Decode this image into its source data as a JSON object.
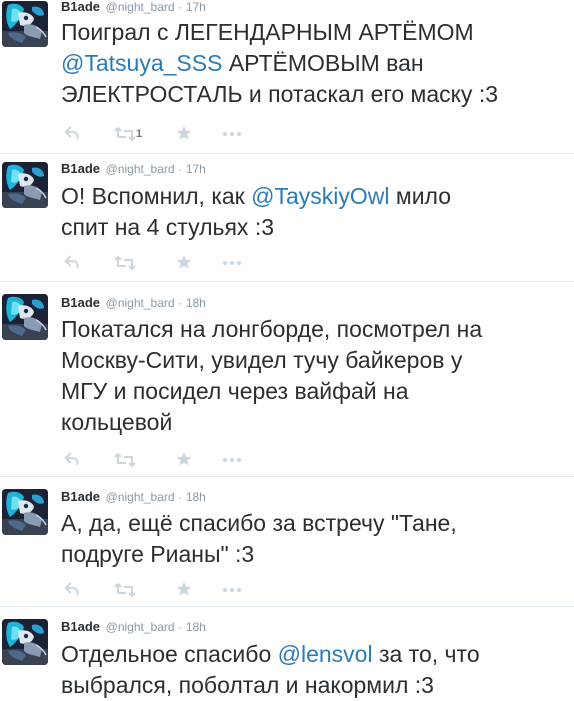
{
  "colors": {
    "mention": "#2b7bb9",
    "muted": "#8899a6",
    "text": "#292f33",
    "action_icon": "#ccd6dd"
  },
  "tweets": [
    {
      "name": "B1ade",
      "handle": "@night_bard",
      "separator": "·",
      "time": "17h",
      "text": {
        "l1a": "Поиграл с ЛЕГЕНДАРНЫМ АРТЁМОМ",
        "l2m": "@Tatsuya_SSS",
        "l2b": " АРТЁМОВЫМ ван",
        "l3": "ЭЛЕКТРОСТАЛЬ и потаскал его маску :3"
      },
      "retweet_count": "1"
    },
    {
      "name": "B1ade",
      "handle": "@night_bard",
      "separator": "·",
      "time": "17h",
      "text": {
        "l1a": "О! Вспомнил, как ",
        "l1m": "@TayskiyOwl",
        "l1b": " мило",
        "l2": "спит на 4 стульях :3"
      }
    },
    {
      "name": "B1ade",
      "handle": "@night_bard",
      "separator": "·",
      "time": "18h",
      "text": {
        "l1": "Покатался на лонгборде, посмотрел на",
        "l2": "Москву-Сити, увидел тучу байкеров у",
        "l3": "МГУ и посидел через вайфай на",
        "l4": "кольцевой"
      }
    },
    {
      "name": "B1ade",
      "handle": "@night_bard",
      "separator": "·",
      "time": "18h",
      "text": {
        "l1": "А, да, ещё спасибо за встречу \"Тане,",
        "l2": "подруге Рианы\" :3"
      }
    },
    {
      "name": "B1ade",
      "handle": "@night_bard",
      "separator": "·",
      "time": "18h",
      "text": {
        "l1a": "Отдельное спасибо ",
        "l1m": "@lensvol",
        "l1b": " за то, что",
        "l2": "выбрался, поболтал и накормил :3"
      }
    }
  ]
}
